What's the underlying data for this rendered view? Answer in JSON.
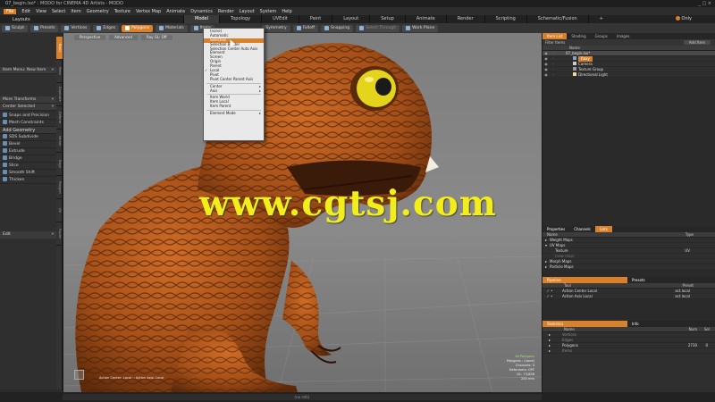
{
  "app": {
    "title": "07_begin.lxo* : MODO for CINEMA 4D Artists - MODO",
    "window_controls": "_ □ ×"
  },
  "menubar": [
    "File",
    "Edit",
    "View",
    "Select",
    "Item",
    "Geometry",
    "Texture",
    "Vertex Map",
    "Animate",
    "Dynamics",
    "Render",
    "Layout",
    "System",
    "Help"
  ],
  "layoutbar": {
    "label": "Layouts",
    "tabs": [
      "Model",
      "Topology",
      "UVEdit",
      "Paint",
      "Layout",
      "Setup",
      "Animate",
      "Render",
      "Scripting",
      "Schematic/Fusion"
    ],
    "active_tab": "Model",
    "add": "+",
    "only": "Only"
  },
  "toolbar": {
    "buttons": [
      "Sculpt",
      "Presets",
      "Vertices",
      "Edges",
      "Polygons",
      "Materials",
      "Items",
      "Symmetry",
      "Falloff",
      "Snapping",
      "Select Through",
      "Work Plane"
    ],
    "active": "Polygons"
  },
  "leftpanel": {
    "items": [
      {
        "label": "Item Menu: New Item",
        "kind": "dropdown"
      },
      {
        "label": "More Transforms",
        "kind": "dropdown"
      },
      {
        "label": "Center Selected",
        "kind": "dropdown"
      },
      {
        "label": "Snaps and Precision",
        "kind": "item"
      },
      {
        "label": "Mesh Constraints",
        "kind": "item"
      },
      {
        "label": "Add Geometry",
        "kind": "group"
      },
      {
        "label": "SDS Subdivide",
        "kind": "item"
      },
      {
        "label": "Bevel",
        "kind": "item"
      },
      {
        "label": "Extrude",
        "kind": "item"
      },
      {
        "label": "Bridge",
        "kind": "item"
      },
      {
        "label": "Slice",
        "kind": "item"
      },
      {
        "label": "Smooth Shift",
        "kind": "item"
      },
      {
        "label": "Thicken",
        "kind": "item"
      }
    ],
    "edit_field": "Edit"
  },
  "leftstrip": [
    "Basic",
    "Mesh",
    "Duplicate",
    "Deform",
    "Vertex",
    "Edge",
    "Polygon",
    "UV",
    "Fusion"
  ],
  "viewport": {
    "header_buttons": [
      "Perspective",
      "Advanced",
      "Ray GL: Off"
    ],
    "watermark": "www.cgtsj.com",
    "status": "Action Center: Local :: Action Axis: Local",
    "info": [
      "All Polygons",
      "Polygons : (none)",
      "Channels: 3",
      "Deformers: OFF",
      "GL: 73,856",
      "200 mm"
    ]
  },
  "context_menu": {
    "items": [
      {
        "label": "(none)"
      },
      {
        "label": "Automatic"
      },
      {
        "label": "Selection",
        "active": true
      },
      {
        "label": "Selection Border"
      },
      {
        "label": "Selection Center Auto Axis"
      },
      {
        "label": "Element"
      },
      {
        "label": "Screen"
      },
      {
        "label": "Origin"
      },
      {
        "label": "Parent"
      },
      {
        "label": "Local",
        "checked": true
      },
      {
        "label": "Pivot"
      },
      {
        "label": "Pivot Center Parent Axis"
      },
      {
        "sep": true
      },
      {
        "label": "Center",
        "sub": true
      },
      {
        "label": "Axis",
        "sub": true
      },
      {
        "sep": true
      },
      {
        "label": "Item World"
      },
      {
        "label": "Item Local"
      },
      {
        "label": "Item Parent"
      },
      {
        "sep": true
      },
      {
        "label": "Element Mode",
        "sub": true
      }
    ]
  },
  "rightpanel": {
    "top_tabs": [
      "Item List",
      "Shading",
      "Groups",
      "Images"
    ],
    "filter": "Filter Items",
    "add_item": "Add Item",
    "name_header": "Name",
    "items": [
      {
        "label": "07_begin.lxo*",
        "indent": 10
      },
      {
        "label": "Raxy",
        "indent": 18,
        "highlight": true
      },
      {
        "label": "Camera",
        "indent": 18
      },
      {
        "label": "Texture Group",
        "indent": 18
      },
      {
        "label": "Directional Light",
        "indent": 18
      }
    ],
    "mid_tabs": [
      "Properties",
      "Channels",
      "Lists"
    ],
    "mid_active": "Lists",
    "mid_header": {
      "name": "Name",
      "type": "Type"
    },
    "lists": [
      {
        "label": "Weight Maps",
        "type": ""
      },
      {
        "label": "UV Maps",
        "type": ""
      },
      {
        "label": "Texture",
        "type": "UV"
      },
      {
        "label": "(new map)",
        "type": ""
      },
      {
        "label": "Morph Maps",
        "type": ""
      },
      {
        "label": "Particle Maps",
        "type": ""
      }
    ],
    "pipeline_tabs": [
      "Pipeline",
      "Presets"
    ],
    "pipeline_header": {
      "tool": "Tool",
      "preset": "Preset"
    },
    "pipeline": [
      {
        "tool": "Action Center Local",
        "preset": "act.local"
      },
      {
        "tool": "Action Axis Local",
        "preset": "act.local"
      }
    ],
    "stats_tabs": [
      "Statistics",
      "Info"
    ],
    "stats_header": {
      "name": "Name",
      "num": "Num",
      "sel": "Sel"
    },
    "stats": [
      {
        "label": "Vertices",
        "num": "",
        "sel": ""
      },
      {
        "label": "Edges",
        "num": "",
        "sel": ""
      },
      {
        "label": "Polygons",
        "num": "2730",
        "sel": "0"
      },
      {
        "label": "Items",
        "num": "",
        "sel": ""
      }
    ]
  },
  "bottombar": {
    "command": "(no info)"
  },
  "colors": {
    "accent": "#d9812a",
    "watermark": "#f3ee1a",
    "dino_body": "#b35a1e"
  }
}
